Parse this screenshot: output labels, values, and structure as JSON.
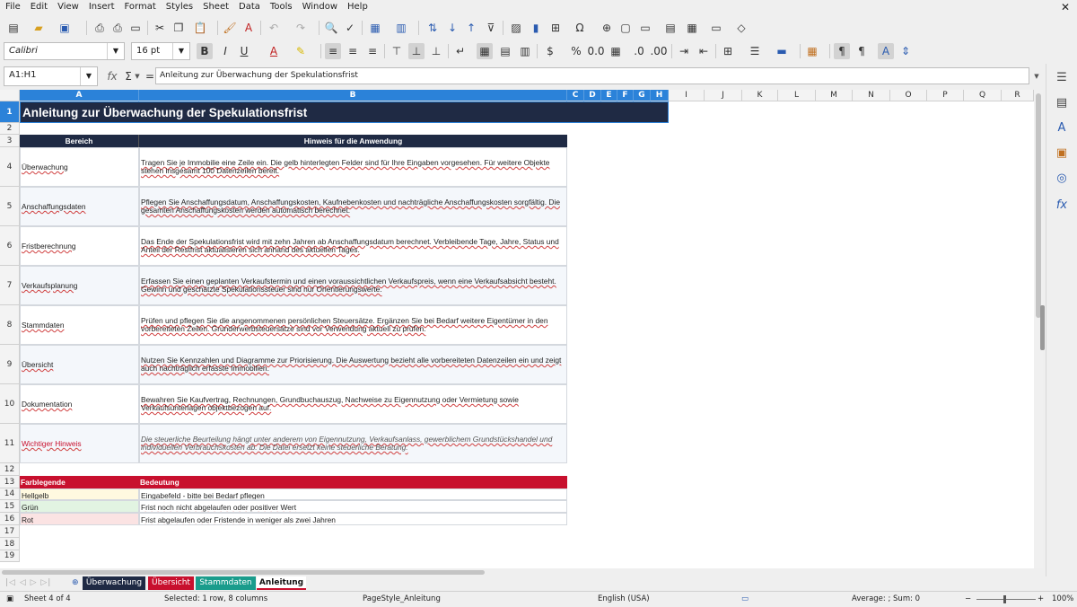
{
  "menu": [
    "File",
    "Edit",
    "View",
    "Insert",
    "Format",
    "Styles",
    "Sheet",
    "Data",
    "Tools",
    "Window",
    "Help"
  ],
  "font_name": "Calibri",
  "font_size": "16 pt",
  "name_box": "A1:H1",
  "formula": "Anleitung zur Überwachung der Spekulationsfrist",
  "columns": [
    "A",
    "B",
    "C",
    "D",
    "E",
    "F",
    "G",
    "H",
    "I",
    "J",
    "K",
    "L",
    "M",
    "N",
    "O",
    "P",
    "Q",
    "R"
  ],
  "rows": [
    "1",
    "2",
    "3",
    "4",
    "5",
    "6",
    "7",
    "8",
    "9",
    "10",
    "11",
    "12",
    "13",
    "14",
    "15",
    "16",
    "17",
    "18",
    "19"
  ],
  "title": "Anleitung zur Überwachung der Spekulationsfrist",
  "table_header": {
    "a": "Bereich",
    "b": "Hinweis für die Anwendung"
  },
  "entries": [
    {
      "a": "Überwachung",
      "b": "Tragen Sie je Immobilie eine Zeile ein. Die gelb hinterlegten Felder sind für Ihre Eingaben vorgesehen. Für weitere Objekte stehen insgesamt 100 Datenzeilen bereit."
    },
    {
      "a": "Anschaffungsdaten",
      "b": "Pflegen Sie Anschaffungsdatum, Anschaffungskosten, Kaufnebenkosten und nachträgliche Anschaffungskosten sorgfältig. Die gesamten Anschaffungskosten werden automatisch berechnet."
    },
    {
      "a": "Fristberechnung",
      "b": "Das Ende der Spekulationsfrist wird mit zehn Jahren ab Anschaffungsdatum berechnet. Verbleibende Tage, Jahre, Status und Anteil der Restfrist aktualisieren sich anhand des aktuellen Tages."
    },
    {
      "a": "Verkaufsplanung",
      "b": "Erfassen Sie einen geplanten Verkaufstermin und einen voraussichtlichen Verkaufspreis, wenn eine Verkaufsabsicht besteht. Gewinn und geschätzte Spekulationssteuer sind nur Orientierungswerte."
    },
    {
      "a": "Stammdaten",
      "b": "Prüfen und pflegen Sie die angenommenen persönlichen Steuersätze. Ergänzen Sie bei Bedarf weitere Eigentümer in den vorbereiteten Zeilen. Grunderwerbsteuersätze sind vor Verwendung aktuell zu prüfen."
    },
    {
      "a": "Übersicht",
      "b": "Nutzen Sie Kennzahlen und Diagramme zur Priorisierung. Die Auswertung bezieht alle vorbereiteten Datenzeilen ein und zeigt auch nachträglich erfasste Immobilien."
    },
    {
      "a": "Dokumentation",
      "b": "Bewahren Sie Kaufvertrag, Rechnungen, Grundbuchauszug, Nachweise zu Eigennutzung oder Vermietung sowie Verkaufsunterlagen objektbezogen auf."
    },
    {
      "a": "Wichtiger Hinweis",
      "b": "Die steuerliche Beurteilung hängt unter anderem von Eigennutzung, Verkaufsanlass, gewerblichem Grundstückshandel und individuellen Verbrauchskosten ab. Die Datei ersetzt keine steuerliche Beratung."
    }
  ],
  "legend_header": {
    "a": "Farblegende",
    "b": "Bedeutung"
  },
  "legend": [
    {
      "a": "Hellgelb",
      "b": "Eingabefeld - bitte bei Bedarf pflegen",
      "color": "#fff9e0"
    },
    {
      "a": "Grün",
      "b": "Frist noch nicht abgelaufen oder positiver Wert",
      "color": "#e2f4e2"
    },
    {
      "a": "Rot",
      "b": "Frist abgelaufen oder Fristende in weniger als zwei Jahren",
      "color": "#fbe3e3"
    }
  ],
  "sheet_tabs": [
    {
      "label": "Überwachung",
      "color": "#1f2a44"
    },
    {
      "label": "Übersicht",
      "color": "#c8102e"
    },
    {
      "label": "Stammdaten",
      "color": "#1a9c8c"
    },
    {
      "label": "Anleitung",
      "color": "#ffffff"
    }
  ],
  "status": {
    "sheet": "Sheet 4 of 4",
    "selection": "Selected: 1 row, 8 columns",
    "page_style": "PageStyle_Anleitung",
    "language": "English (USA)",
    "sum": "Average: ; Sum: 0",
    "zoom": "100%"
  },
  "colors": {
    "header_dark": "#1f2a44",
    "accent_red": "#c8102e",
    "selection_blue": "#2b82d9"
  }
}
